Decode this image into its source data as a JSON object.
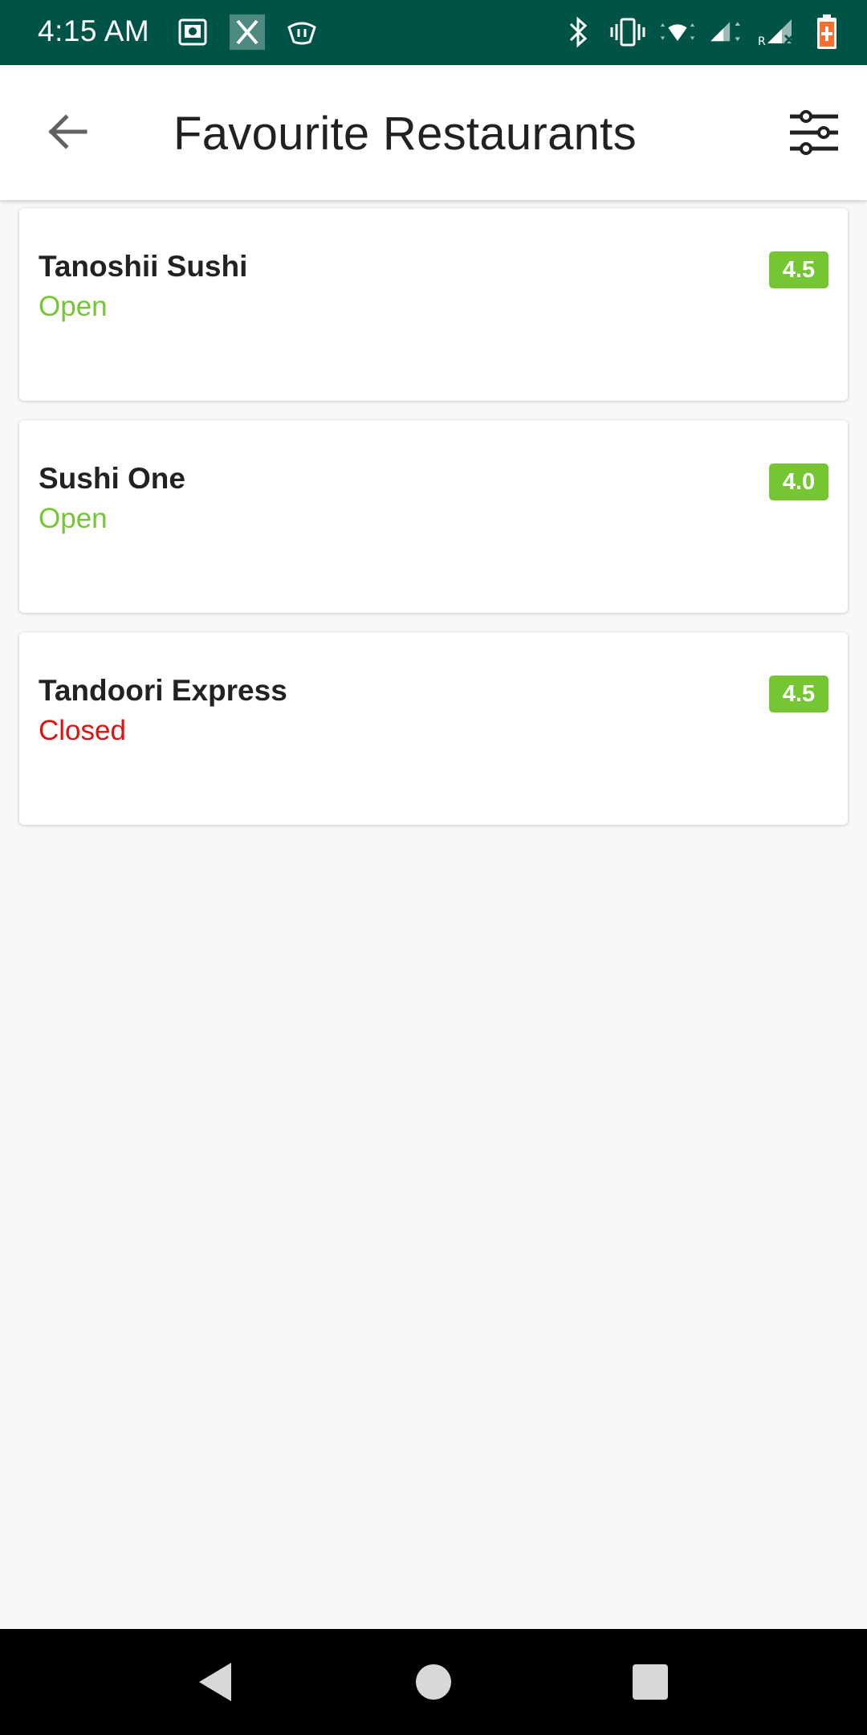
{
  "status_bar": {
    "time": "4:15 AM"
  },
  "app_bar": {
    "title": "Favourite Restaurants",
    "back_icon": "arrow-back-icon",
    "filter_icon": "tune-sliders-icon"
  },
  "restaurants": [
    {
      "name": "Tanoshii Sushi",
      "status": "Open",
      "rating": "4.5"
    },
    {
      "name": "Sushi One",
      "status": "Open",
      "rating": "4.0"
    },
    {
      "name": "Tandoori Express",
      "status": "Closed",
      "rating": "4.5"
    }
  ],
  "colors": {
    "status_bar": "#005447",
    "open": "#76c634",
    "closed": "#e01010",
    "badge": "#76c634"
  }
}
